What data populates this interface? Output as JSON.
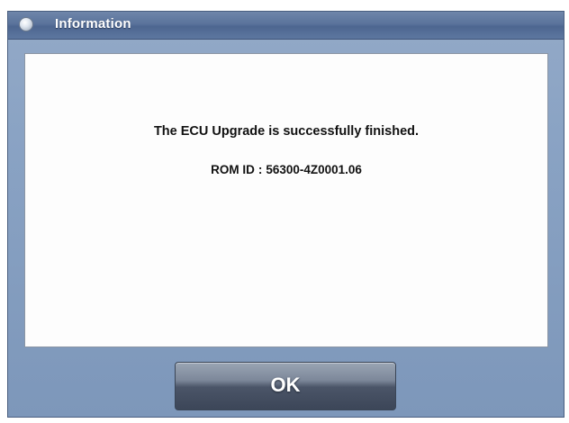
{
  "dialog": {
    "title": "Information",
    "icon": "info-orb-icon",
    "message": "The ECU Upgrade is successfully finished.",
    "rom_id": {
      "label": "ROM ID",
      "separator": ":",
      "value": "56300-4Z0001.06"
    },
    "ok_label": "OK"
  },
  "colors": {
    "titlebar": "#5a739b",
    "window_frame": "#8aa3c4",
    "content_bg": "#fdfdfd",
    "button": "#4b5568",
    "text": "#111111"
  }
}
